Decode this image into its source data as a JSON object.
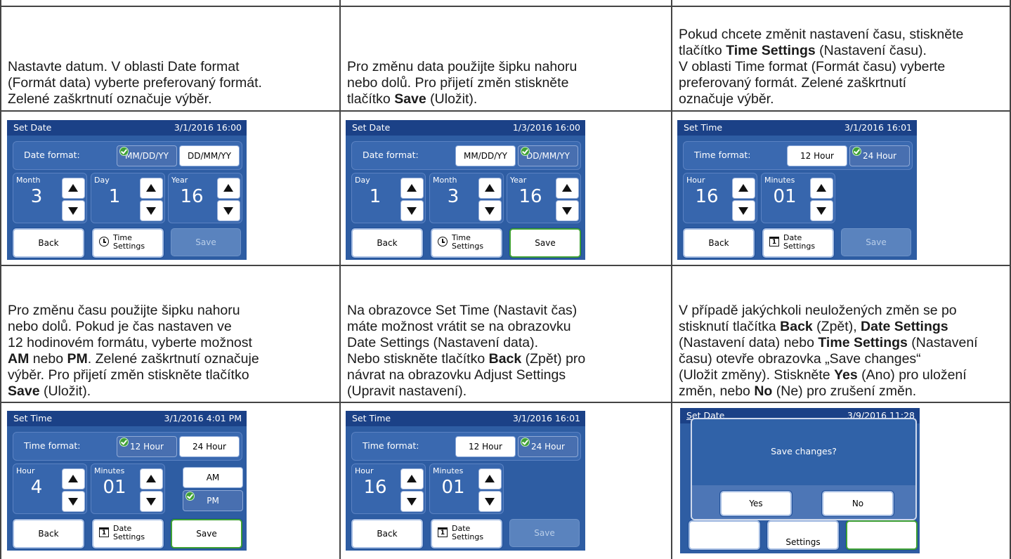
{
  "cells": {
    "c1": {
      "line1": "Nastavte datum. V oblasti Date format",
      "line2": "(Formát data) vyberte preferovaný formát.",
      "line3": "Zelené zaškrtnutí označuje výběr."
    },
    "c2": {
      "line1": "Pro změnu data použijte šipku nahoru",
      "line2": "nebo dolů. Pro přijetí změn stiskněte",
      "line3a": "tlačítko ",
      "line3b": "Save",
      "line3c": " (Uložit)."
    },
    "c3": {
      "line1a": "Pokud chcete změnit nastavení času, stiskněte",
      "line2a": "tlačítko ",
      "line2b": "Time Settings",
      "line2c": " (Nastavení času).",
      "line3": "V oblasti Time format (Formát času) vyberte",
      "line4": "preferovaný formát. Zelené zaškrtnutí",
      "line5": "označuje výběr."
    },
    "c4": {
      "line1": "Pro změnu času použijte šipku nahoru",
      "line2": "nebo dolů. Pokud je čas nastaven ve",
      "line3": "12 hodinovém formátu, vyberte možnost",
      "line4a": "AM",
      "line4b": " nebo ",
      "line4c": "PM",
      "line4d": ". Zelené zaškrtnutí označuje",
      "line5": "výběr. Pro přijetí změn stiskněte tlačítko",
      "line6a": "Save",
      "line6b": " (Uložit)."
    },
    "c5": {
      "line1": "Na obrazovce Set Time (Nastavit čas)",
      "line2": "máte možnost vrátit se na obrazovku",
      "line3": "Date Settings (Nastavení data).",
      "line4a": "Nebo stiskněte tlačítko ",
      "line4b": "Back",
      "line4c": " (Zpět) pro",
      "line5": "návrat na obrazovku Adjust Settings",
      "line6": "(Upravit nastavení)."
    },
    "c6": {
      "line1": "V případě jakýchkoli neuložených změn se po",
      "line2a": "stisknutí tlačítka ",
      "line2b": "Back",
      "line2c": " (Zpět), ",
      "line2d": "Date Settings",
      "line3a": "(Nastavení data) nebo ",
      "line3b": "Time Settings",
      "line3c": " (Nastavení",
      "line4": "času) otevře obrazovka „Save changes“",
      "line5a": "(Uložit změny). Stiskněte ",
      "line5b": "Yes",
      "line5c": " (Ano) pro uložení",
      "line6a": "změn, nebo ",
      "line6b": "No",
      "line6c": " (Ne) pro zrušení změn."
    }
  },
  "screens": {
    "s1": {
      "title": "Set Date",
      "datetime": "3/1/2016 16:00",
      "format_label": "Date format:",
      "opt1": "MM/DD/YY",
      "opt2": "DD/MM/YY",
      "f1_label": "Month",
      "f1_value": "3",
      "f2_label": "Day",
      "f2_value": "1",
      "f3_label": "Year",
      "f3_value": "16",
      "back": "Back",
      "mid1": "Time",
      "mid2": "Settings",
      "save": "Save"
    },
    "s2": {
      "title": "Set Date",
      "datetime": "1/3/2016 16:00",
      "format_label": "Date format:",
      "opt1": "MM/DD/YY",
      "opt2": "DD/MM/YY",
      "f1_label": "Day",
      "f1_value": "1",
      "f2_label": "Month",
      "f2_value": "3",
      "f3_label": "Year",
      "f3_value": "16",
      "back": "Back",
      "mid1": "Time",
      "mid2": "Settings",
      "save": "Save"
    },
    "s3": {
      "title": "Set Time",
      "datetime": "3/1/2016 16:01",
      "format_label": "Time format:",
      "opt1": "12 Hour",
      "opt2": "24 Hour",
      "f1_label": "Hour",
      "f1_value": "16",
      "f2_label": "Minutes",
      "f2_value": "01",
      "back": "Back",
      "mid1": "Date",
      "mid2": "Settings",
      "save": "Save",
      "cal_day": "1"
    },
    "s4": {
      "title": "Set Time",
      "datetime": "3/1/2016 4:01 PM",
      "format_label": "Time format:",
      "opt1": "12 Hour",
      "opt2": "24 Hour",
      "f1_label": "Hour",
      "f1_value": "4",
      "f2_label": "Minutes",
      "f2_value": "01",
      "am": "AM",
      "pm": "PM",
      "back": "Back",
      "mid1": "Date",
      "mid2": "Settings",
      "save": "Save",
      "cal_day": "1"
    },
    "s5": {
      "title": "Set Time",
      "datetime": "3/1/2016 16:01",
      "format_label": "Time format:",
      "opt1": "12 Hour",
      "opt2": "24 Hour",
      "f1_label": "Hour",
      "f1_value": "16",
      "f2_label": "Minutes",
      "f2_value": "01",
      "back": "Back",
      "mid1": "Date",
      "mid2": "Settings",
      "save": "Save",
      "cal_day": "1"
    },
    "s6": {
      "title": "Set Date",
      "datetime": "3/9/2016 11:28",
      "question": "Save changes?",
      "yes": "Yes",
      "no": "No",
      "behind": "Settings"
    }
  },
  "colors": {
    "screen_bg": "#2e5da3",
    "titlebar": "#1b4187",
    "check_green": "#3fa035"
  }
}
